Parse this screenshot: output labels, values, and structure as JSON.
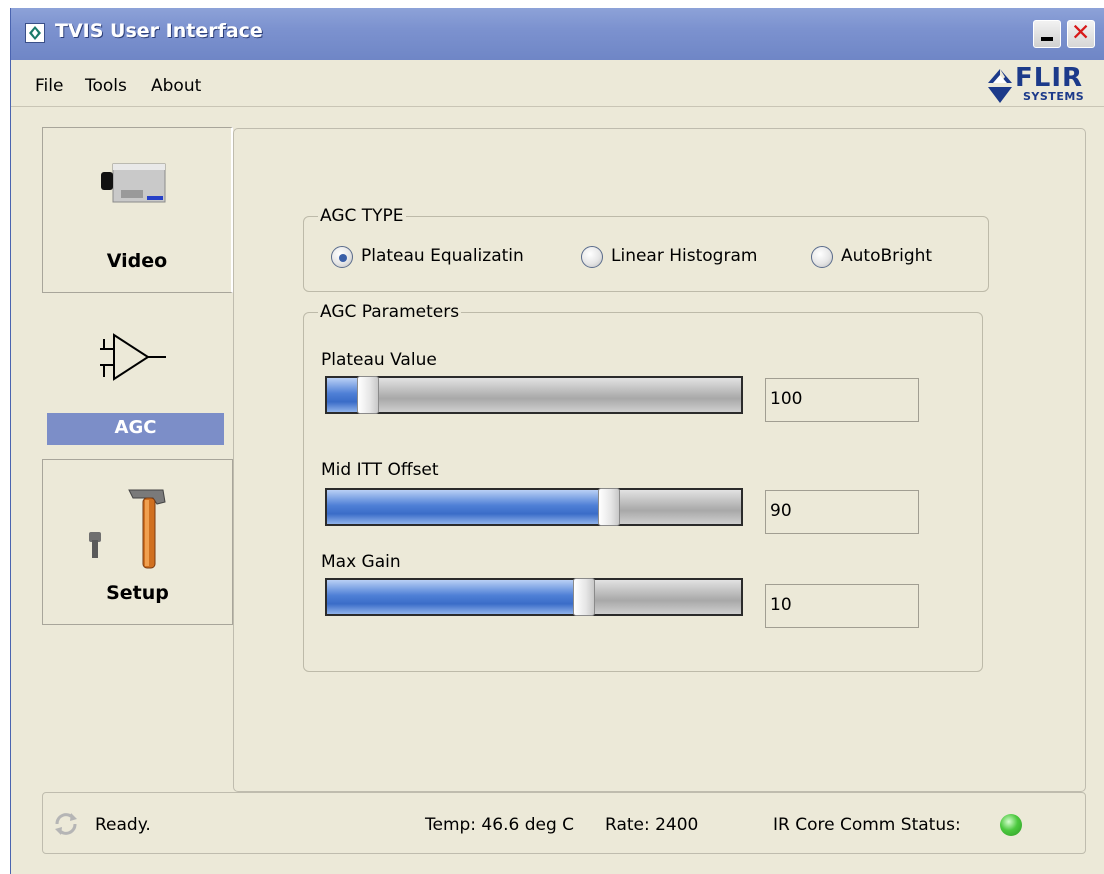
{
  "window": {
    "title": "TVIS User Interface"
  },
  "menu": {
    "items": [
      "File",
      "Tools",
      "About"
    ]
  },
  "logo": {
    "brand": "FLIR",
    "sub": "SYSTEMS"
  },
  "nav": {
    "tabs": [
      {
        "label": "Video",
        "icon": "video-camera-icon",
        "selected": false
      },
      {
        "label": "AGC",
        "icon": "amplifier-icon",
        "selected": true
      },
      {
        "label": "Setup",
        "icon": "hammer-icon",
        "selected": false
      }
    ]
  },
  "agc_type": {
    "legend": "AGC TYPE",
    "options": [
      {
        "label": "Plateau Equalizatin",
        "checked": true
      },
      {
        "label": "Linear Histogram",
        "checked": false
      },
      {
        "label": "AutoBright",
        "checked": false
      }
    ]
  },
  "agc_params": {
    "legend": "AGC Parameters",
    "sliders": [
      {
        "label": "Plateau Value",
        "value": "100",
        "fill_fraction": 0.1
      },
      {
        "label": "Mid ITT Offset",
        "value": "90",
        "fill_fraction": 0.68
      },
      {
        "label": "Max Gain",
        "value": "10",
        "fill_fraction": 0.62
      }
    ]
  },
  "status": {
    "ready": "Ready.",
    "temp": "Temp: 46.6 deg C",
    "rate": "Rate: 2400",
    "comm_label": "IR Core Comm Status:",
    "comm_color": "#4cc93f"
  },
  "colors": {
    "titlebar": "#7c92cf",
    "selected_tab": "#7c8ec8",
    "slider_fill": "#3a6cc8"
  }
}
